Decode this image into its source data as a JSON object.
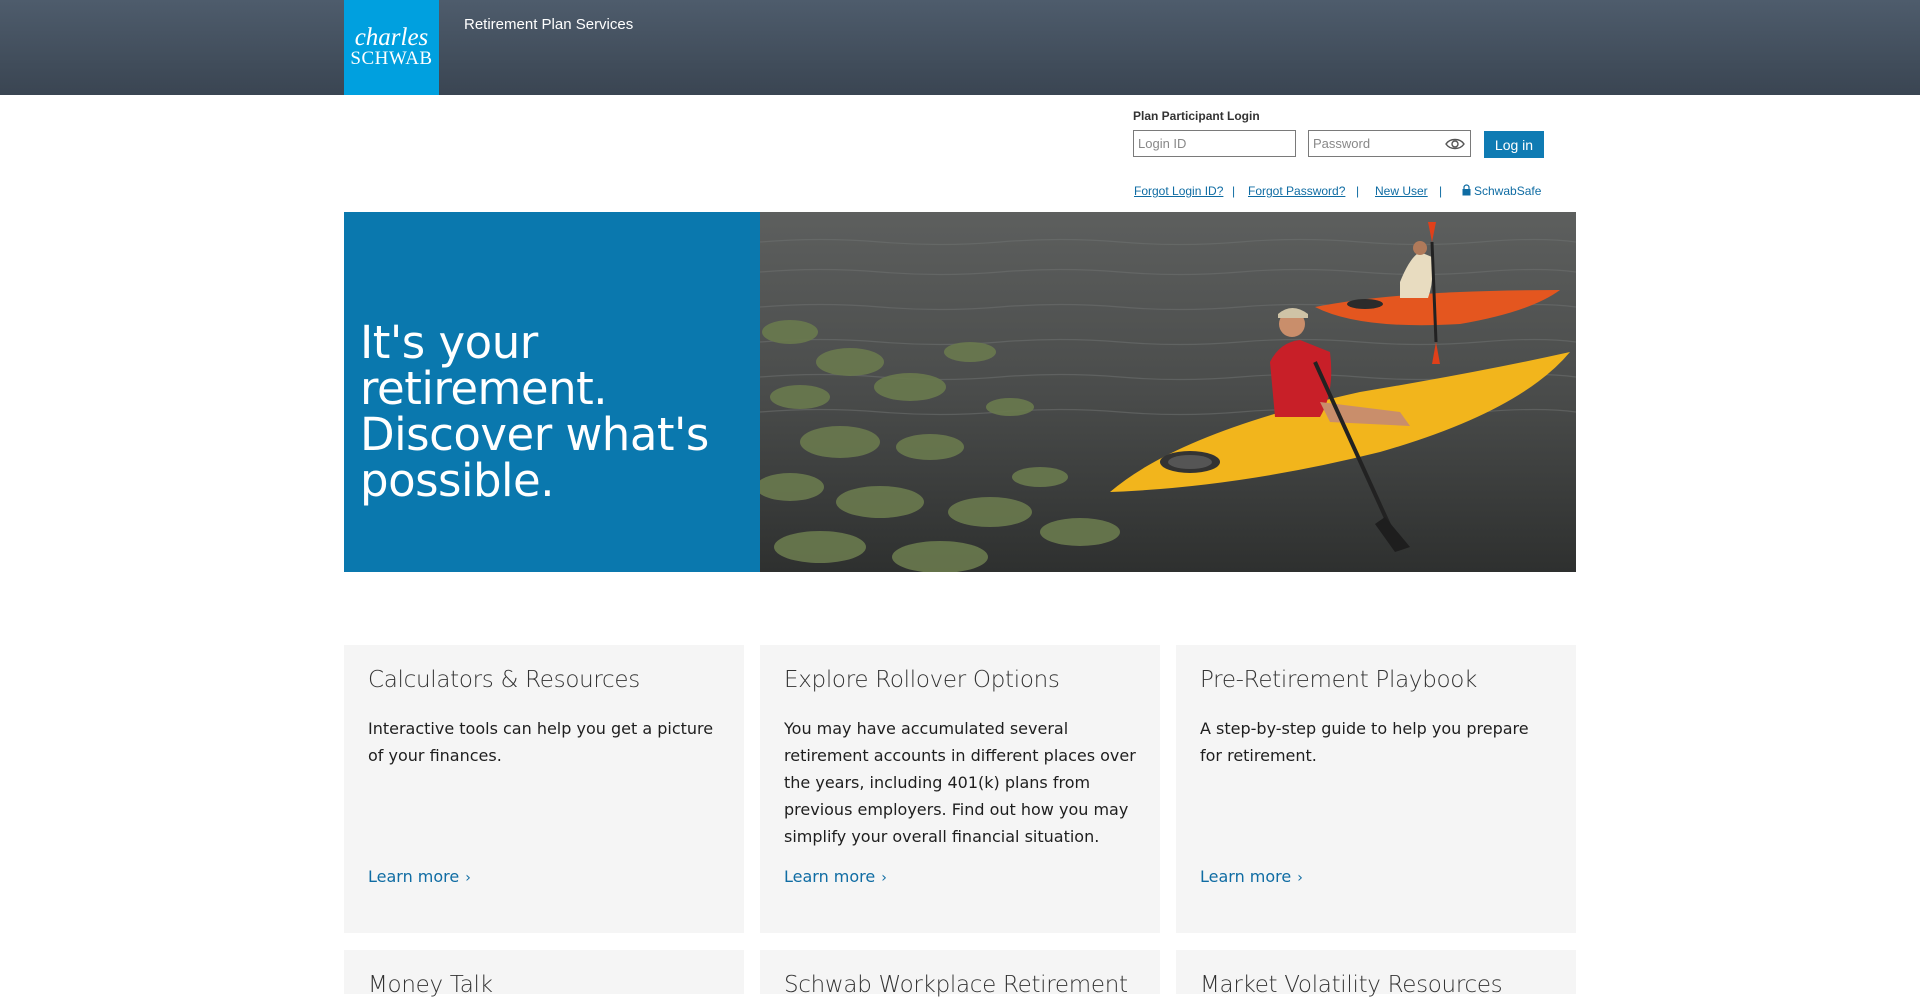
{
  "header": {
    "logo_line1": "charles",
    "logo_line2": "SCHWAB",
    "site_title": "Retirement Plan Services"
  },
  "login": {
    "section_label": "Plan Participant Login",
    "login_id_placeholder": "Login ID",
    "password_placeholder": "Password",
    "login_button": "Log in",
    "links": {
      "forgot_login": "Forgot Login ID?",
      "forgot_password": "Forgot Password?",
      "new_user": "New User",
      "schwab_safe": "SchwabSafe"
    },
    "separator": "|"
  },
  "hero": {
    "headline": "It's your retirement. Discover what's possible."
  },
  "cards": [
    {
      "title": "Calculators & Resources",
      "body": "Interactive tools can help you get a picture of your finances.",
      "link": "Learn more"
    },
    {
      "title": "Explore Rollover Options",
      "body": "You may have accumulated several retirement accounts in different places over the years, including 401(k) plans from previous employers. Find out how you may simplify your overall financial situation.",
      "link": "Learn more"
    },
    {
      "title": "Pre-Retirement Playbook",
      "body": "A step-by-step guide to help you prepare for retirement.",
      "link": "Learn more"
    },
    {
      "title": "Money Talk"
    },
    {
      "title": "Schwab Workplace Retirement"
    },
    {
      "title": "Market Volatility Resources"
    }
  ],
  "colors": {
    "brand_blue": "#00a0df",
    "hero_blue": "#0a78ae",
    "link_blue": "#0f6ca3",
    "header_bg": "#46525f"
  }
}
